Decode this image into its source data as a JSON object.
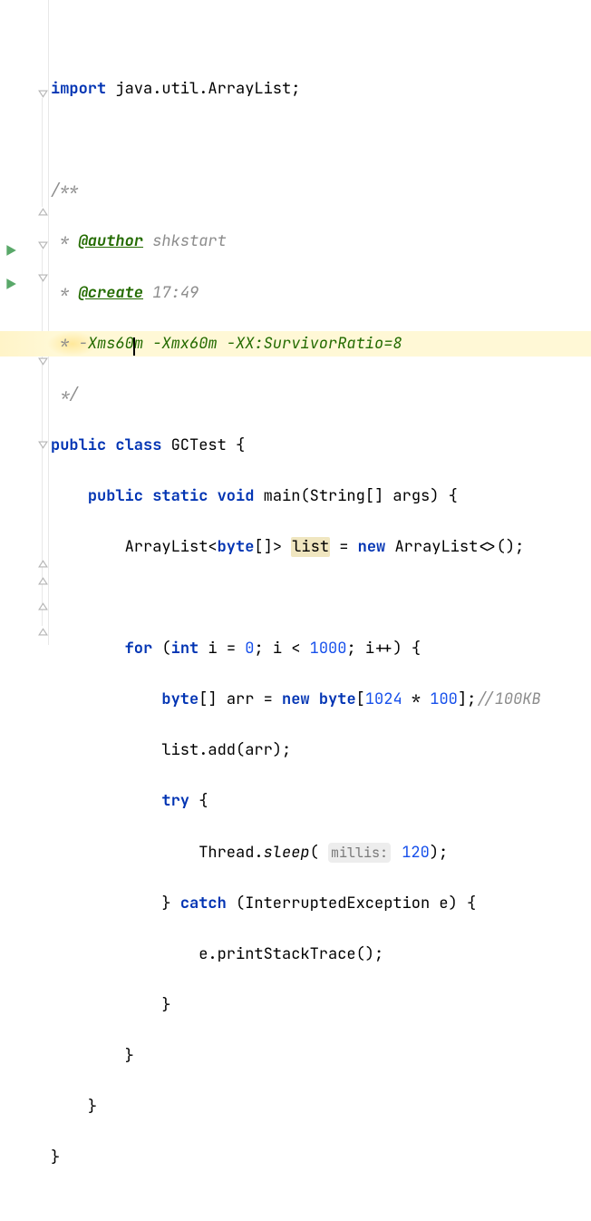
{
  "code": {
    "import_kw": "import",
    "import_pkg": " java.util.ArrayList;",
    "doc_open": "/**",
    "doc_author_tag": "@author",
    "doc_author_val": " shkstart",
    "doc_create_tag": "@create",
    "doc_create_val": " 17:49",
    "doc_jvm_pre": " * -",
    "doc_jvm_a": "Xms60",
    "doc_jvm_b": "m -Xmx60m -XX:SurvivorRatio=8",
    "doc_close": " */",
    "class_kw": "public class ",
    "class_name": "GCTest {",
    "main_kw": "public static void ",
    "main_name": "main",
    "main_args_1": "(String[] args) {",
    "list_decl_1": "ArrayList<",
    "list_decl_2": "byte",
    "list_decl_3": "[]> ",
    "list_var": "list",
    "list_decl_4": " = ",
    "list_new": "new",
    "list_decl_5": " ArrayList<>();",
    "for_kw": "for",
    "for_open": " (",
    "for_int": "int",
    "for_i1": " i = ",
    "for_zero": "0",
    "for_sc1": "; i < ",
    "for_lim": "1000",
    "for_sc2": "; i++) {",
    "arr_byte": "byte",
    "arr_decl1": "[] arr = ",
    "arr_new": "new",
    "arr_decl2": " ",
    "arr_byte2": "byte",
    "arr_decl3": "[",
    "arr_n1": "1024",
    "arr_mul": " * ",
    "arr_n2": "100",
    "arr_decl4": "];",
    "arr_comment": "//100KB",
    "add_line": "list.add(arr);",
    "try_kw": "try",
    "try_open": " {",
    "sleep_pre": "Thread.",
    "sleep_fn": "sleep",
    "sleep_open": "( ",
    "sleep_hint": "millis:",
    "sleep_val": "120",
    "sleep_close": ");",
    "catch_close": "} ",
    "catch_kw": "catch",
    "catch_args": " (InterruptedException e) {",
    "print_line": "e.printStackTrace();",
    "brace": "}"
  },
  "icons": {
    "run1": "run-icon",
    "run2": "run-icon"
  }
}
